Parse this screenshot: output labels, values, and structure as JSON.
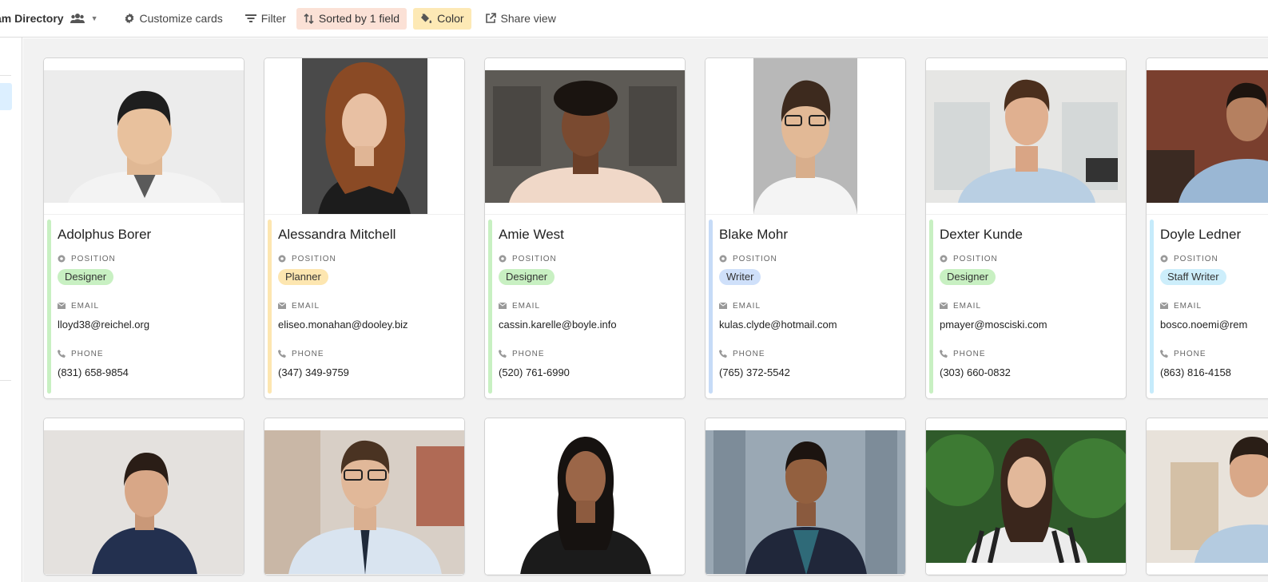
{
  "toolbar": {
    "view_title": "am Directory",
    "customize_label": "Customize cards",
    "filter_label": "Filter",
    "sorted_label": "Sorted by 1 field",
    "color_label": "Color",
    "share_label": "Share view"
  },
  "field_labels": {
    "position": "POSITION",
    "email": "EMAIL",
    "phone": "PHONE"
  },
  "colors": {
    "designer": "#c8f0c2",
    "planner": "#fde6b0",
    "writer": "#cfe0fa",
    "staff_writer": "#cdeefb",
    "accent_green": "#c8f0c2",
    "accent_yellow": "#fde6b0",
    "accent_blue": "#c6dbf7",
    "accent_cyan": "#c6ebfb"
  },
  "cards_row1": [
    {
      "name": "Adolphus Borer",
      "position": "Designer",
      "email": "lloyd38@reichel.org",
      "phone": "(831) 658-9854",
      "photo_icon": "portrait-photo"
    },
    {
      "name": "Alessandra Mitchell",
      "position": "Planner",
      "email": "eliseo.monahan@dooley.biz",
      "phone": "(347) 349-9759",
      "photo_icon": "portrait-photo"
    },
    {
      "name": "Amie West",
      "position": "Designer",
      "email": "cassin.karelle@boyle.info",
      "phone": "(520) 761-6990",
      "photo_icon": "portrait-photo"
    },
    {
      "name": "Blake Mohr",
      "position": "Writer",
      "email": "kulas.clyde@hotmail.com",
      "phone": "(765) 372-5542",
      "photo_icon": "portrait-photo"
    },
    {
      "name": "Dexter Kunde",
      "position": "Designer",
      "email": "pmayer@mosciski.com",
      "phone": "(303) 660-0832",
      "photo_icon": "portrait-photo"
    },
    {
      "name": "Doyle Ledner",
      "position": "Staff Writer",
      "email": "bosco.noemi@rem",
      "phone": "(863) 816-4158",
      "photo_icon": "portrait-photo"
    }
  ]
}
